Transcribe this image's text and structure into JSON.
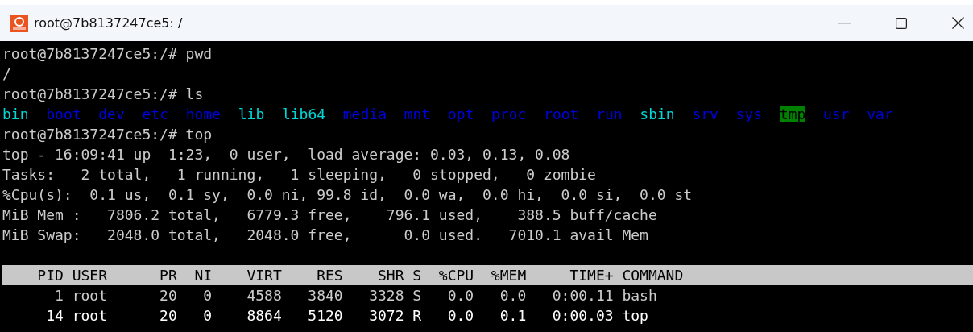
{
  "window": {
    "title": "root@7b8137247ce5: /"
  },
  "terminal": {
    "lines": [
      {
        "kind": "text",
        "text": "root@7b8137247ce5:/# pwd"
      },
      {
        "kind": "text",
        "text": "/"
      },
      {
        "kind": "text",
        "text": "root@7b8137247ce5:/# ls"
      },
      {
        "kind": "listing",
        "entries": [
          {
            "name": "bin",
            "kind": "link"
          },
          {
            "name": "boot",
            "kind": "dir"
          },
          {
            "name": "dev",
            "kind": "dir"
          },
          {
            "name": "etc",
            "kind": "dir"
          },
          {
            "name": "home",
            "kind": "dir"
          },
          {
            "name": "lib",
            "kind": "link"
          },
          {
            "name": "lib64",
            "kind": "link"
          },
          {
            "name": "media",
            "kind": "dir"
          },
          {
            "name": "mnt",
            "kind": "dir"
          },
          {
            "name": "opt",
            "kind": "dir"
          },
          {
            "name": "proc",
            "kind": "dir"
          },
          {
            "name": "root",
            "kind": "dir"
          },
          {
            "name": "run",
            "kind": "dir"
          },
          {
            "name": "sbin",
            "kind": "link"
          },
          {
            "name": "srv",
            "kind": "dir"
          },
          {
            "name": "sys",
            "kind": "dir"
          },
          {
            "name": "tmp",
            "kind": "sticky"
          },
          {
            "name": "usr",
            "kind": "dir"
          },
          {
            "name": "var",
            "kind": "dir"
          }
        ]
      },
      {
        "kind": "text",
        "text": "root@7b8137247ce5:/# top"
      },
      {
        "kind": "text",
        "text": "top - 16:09:41 up  1:23,  0 user,  load average: 0.03, 0.13, 0.08"
      },
      {
        "kind": "text",
        "text": "Tasks:   2 total,   1 running,   1 sleeping,   0 stopped,   0 zombie"
      },
      {
        "kind": "text",
        "text": "%Cpu(s):  0.1 us,  0.1 sy,  0.0 ni, 99.8 id,  0.0 wa,  0.0 hi,  0.0 si,  0.0 st"
      },
      {
        "kind": "text",
        "text": "MiB Mem :   7806.2 total,   6779.3 free,    796.1 used,    388.5 buff/cache"
      },
      {
        "kind": "text",
        "text": "MiB Swap:   2048.0 total,   2048.0 free,      0.0 used.   7010.1 avail Mem"
      },
      {
        "kind": "blank"
      },
      {
        "kind": "header",
        "text": "    PID USER      PR  NI    VIRT    RES    SHR S  %CPU  %MEM     TIME+ COMMAND"
      },
      {
        "kind": "process",
        "text": "      1 root      20   0    4588   3840   3328 S   0.0   0.0   0:00.11 bash",
        "highlighted": false
      },
      {
        "kind": "process",
        "text": "     14 root      20   0    8864   5120   3072 R   0.0   0.1   0:00.03 top",
        "highlighted": true
      }
    ]
  }
}
